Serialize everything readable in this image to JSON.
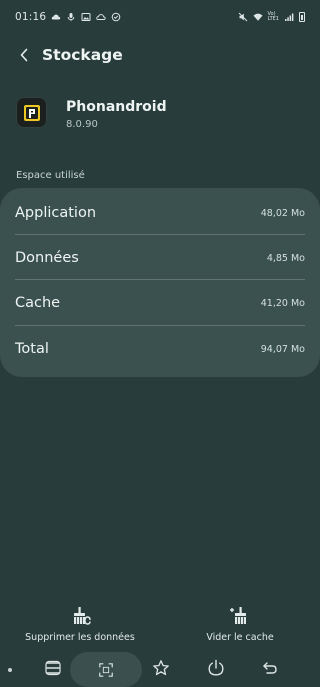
{
  "status_bar": {
    "time": "01:16",
    "left_icons": [
      "cloud-upload-icon",
      "mic-icon",
      "image-icon",
      "cloud-icon",
      "check-circle-icon"
    ],
    "right_icons": [
      "mute-icon",
      "wifi-icon",
      "signal-icon",
      "battery-icon"
    ],
    "network_text_top": "Vo)",
    "network_text_bottom": "LTE1"
  },
  "header": {
    "back_icon": "chevron-left-icon",
    "title": "Stockage"
  },
  "app": {
    "name": "Phonandroid",
    "version": "8.0.90",
    "icon": "phonandroid-app-icon"
  },
  "section_title": "Espace utilisé",
  "storage": [
    {
      "label": "Application",
      "value": "48,02 Mo"
    },
    {
      "label": "Données",
      "value": "4,85 Mo"
    },
    {
      "label": "Cache",
      "value": "41,20 Mo"
    },
    {
      "label": "Total",
      "value": "94,07 Mo"
    }
  ],
  "actions": {
    "clear_data": {
      "label": "Supprimer les données",
      "icon": "broom-c-icon"
    },
    "clear_cache": {
      "label": "Vider le cache",
      "icon": "broom-plus-icon"
    }
  },
  "navbar": {
    "icons": [
      "dot-icon",
      "recent-apps-icon",
      "scan-icon",
      "star-icon",
      "power-icon",
      "back-icon"
    ]
  },
  "colors": {
    "background": "#293c3c",
    "card": "#3b5150",
    "text": "#eef4f2",
    "app_icon_accent": "#f0c623"
  }
}
